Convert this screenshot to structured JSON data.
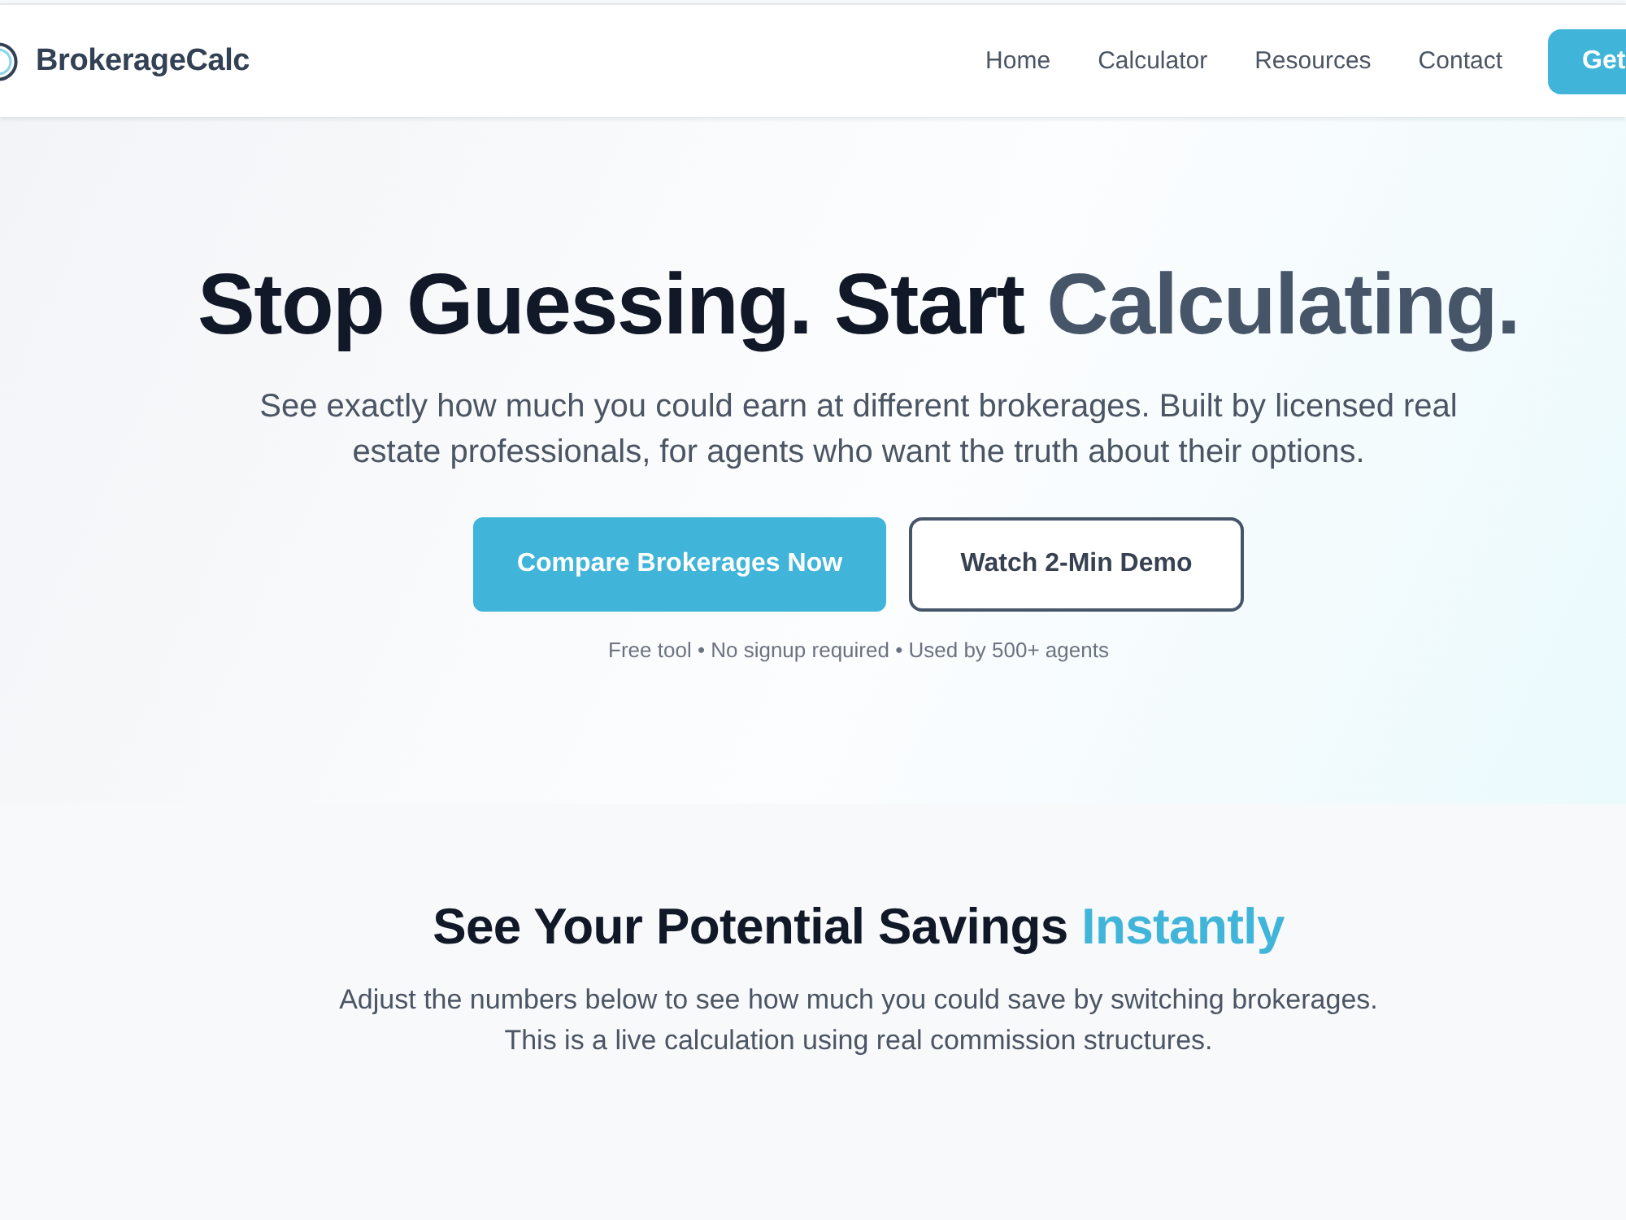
{
  "header": {
    "logo": "BrokerageCalc",
    "nav": [
      {
        "label": "Home"
      },
      {
        "label": "Calculator"
      },
      {
        "label": "Resources"
      },
      {
        "label": "Contact"
      }
    ],
    "cta": "Get"
  },
  "hero": {
    "headline": {
      "text": "Stop Guessing. Start",
      "highlight": "Calculating."
    },
    "subtitle": "See exactly how much you could earn at different brokerages. Built by licensed real estate professionals, for agents who want the truth about their options.",
    "buttons": [
      {
        "label": "Compare Brokerages Now",
        "kind": "primary"
      },
      {
        "label": "Watch 2-Min Demo",
        "kind": "secondary"
      }
    ],
    "note": "Free tool • No signup required • Used by 500+ agents"
  },
  "savings": {
    "heading": {
      "text": "See Your Potential Savings",
      "highlight": "Instantly"
    },
    "description": "Adjust the numbers below to see how much you could save by switching brokerages. This is a live calculation using real commission structures."
  }
}
